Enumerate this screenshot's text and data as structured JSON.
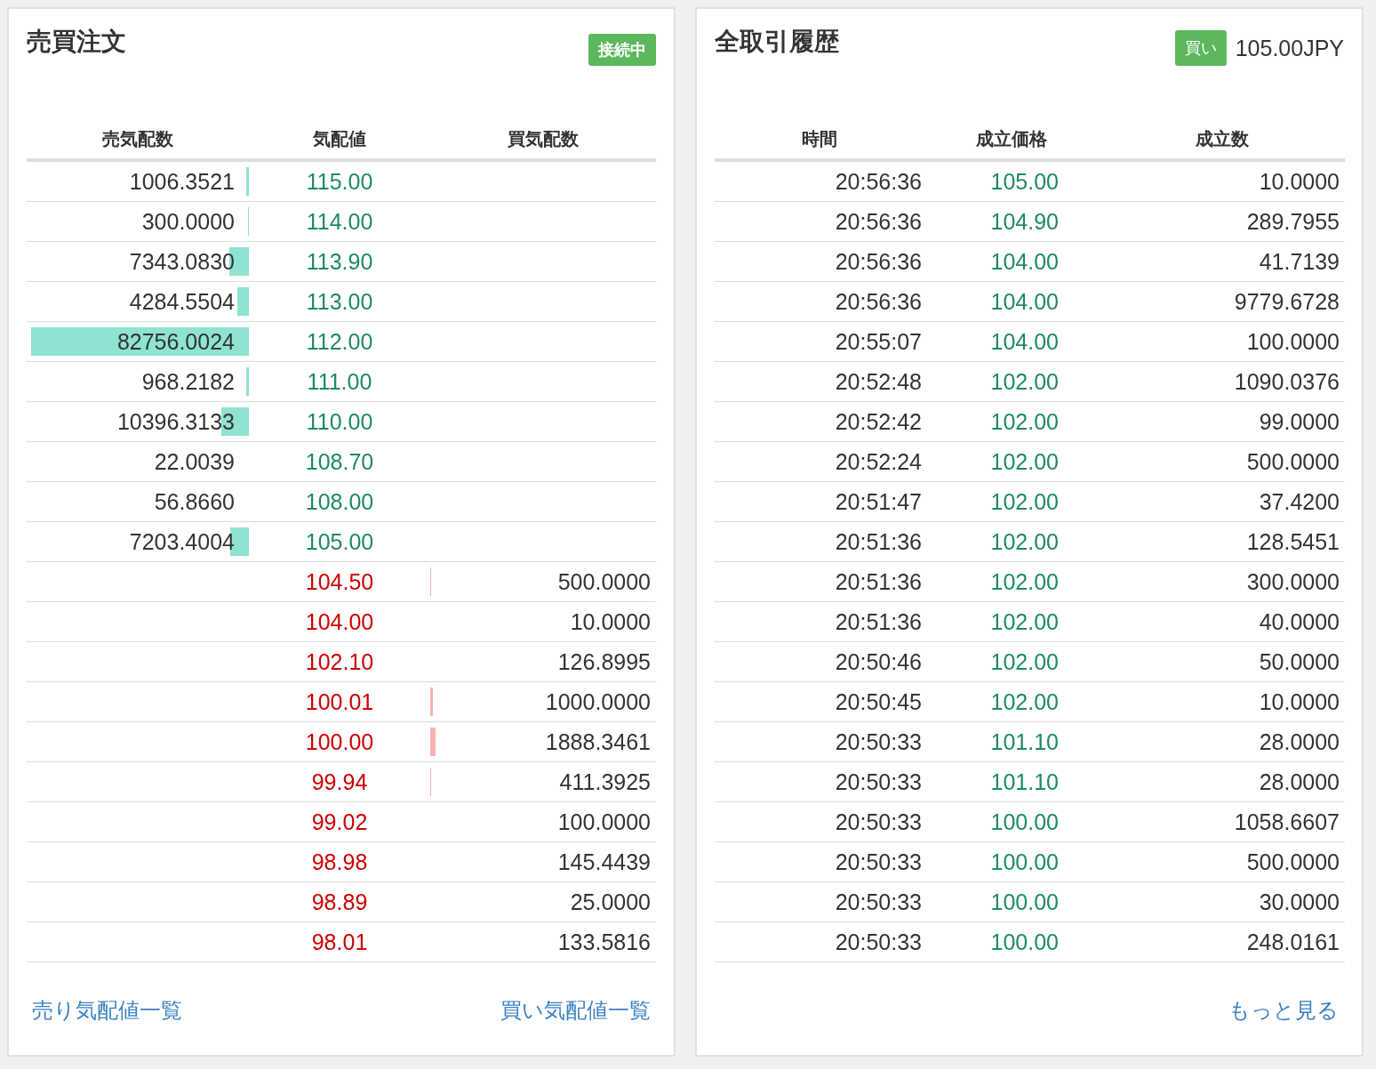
{
  "order_book": {
    "title": "売買注文",
    "status_badge": "接続中",
    "columns": [
      "売気配数",
      "気配値",
      "買気配数"
    ],
    "rows": [
      {
        "kind": "ask",
        "price": "115.00",
        "quantity": "1006.3521",
        "level": 0.012
      },
      {
        "kind": "ask",
        "price": "114.00",
        "quantity": "300.0000",
        "level": 0.004
      },
      {
        "kind": "ask",
        "price": "113.90",
        "quantity": "7343.0830",
        "level": 0.089
      },
      {
        "kind": "ask",
        "price": "113.00",
        "quantity": "4284.5504",
        "level": 0.052
      },
      {
        "kind": "ask",
        "price": "112.00",
        "quantity": "82756.0024",
        "level": 1
      },
      {
        "kind": "ask",
        "price": "111.00",
        "quantity": "968.2182",
        "level": 0.012
      },
      {
        "kind": "ask",
        "price": "110.00",
        "quantity": "10396.3133",
        "level": 0.126
      },
      {
        "kind": "ask",
        "price": "108.70",
        "quantity": "22.0039"
      },
      {
        "kind": "ask",
        "price": "108.00",
        "quantity": "56.8660"
      },
      {
        "kind": "ask",
        "price": "105.00",
        "quantity": "7203.4004",
        "level": 0.087
      },
      {
        "kind": "bid",
        "price": "104.50",
        "quantity": "500.0000",
        "level": 0.004
      },
      {
        "kind": "bid",
        "price": "104.00",
        "quantity": "10.0000"
      },
      {
        "kind": "bid",
        "price": "102.10",
        "quantity": "126.8995"
      },
      {
        "kind": "bid",
        "price": "100.01",
        "quantity": "1000.0000",
        "level": 0.012
      },
      {
        "kind": "bid",
        "price": "100.00",
        "quantity": "1888.3461",
        "level": 0.025
      },
      {
        "kind": "bid",
        "price": "99.94",
        "quantity": "411.3925",
        "level": 0.004
      },
      {
        "kind": "bid",
        "price": "99.02",
        "quantity": "100.0000"
      },
      {
        "kind": "bid",
        "price": "98.98",
        "quantity": "145.4439"
      },
      {
        "kind": "bid",
        "price": "98.89",
        "quantity": "25.0000"
      },
      {
        "kind": "bid",
        "price": "98.01",
        "quantity": "133.5816"
      }
    ],
    "links": [
      "売り気配値一覧",
      "買い気配値一覧"
    ]
  },
  "trade_history": {
    "title": "全取引履歴",
    "side_badge": "買い",
    "last_price": "105.00JPY",
    "columns": [
      "時間",
      "成立価格",
      "成立数"
    ],
    "rows": [
      {
        "time": "20:56:36",
        "price": "105.00",
        "quantity": "10.0000"
      },
      {
        "time": "20:56:36",
        "price": "104.90",
        "quantity": "289.7955"
      },
      {
        "time": "20:56:36",
        "price": "104.00",
        "quantity": "41.7139"
      },
      {
        "time": "20:56:36",
        "price": "104.00",
        "quantity": "9779.6728"
      },
      {
        "time": "20:55:07",
        "price": "104.00",
        "quantity": "100.0000"
      },
      {
        "time": "20:52:48",
        "price": "102.00",
        "quantity": "1090.0376"
      },
      {
        "time": "20:52:42",
        "price": "102.00",
        "quantity": "99.0000"
      },
      {
        "time": "20:52:24",
        "price": "102.00",
        "quantity": "500.0000"
      },
      {
        "time": "20:51:47",
        "price": "102.00",
        "quantity": "37.4200"
      },
      {
        "time": "20:51:36",
        "price": "102.00",
        "quantity": "128.5451"
      },
      {
        "time": "20:51:36",
        "price": "102.00",
        "quantity": "300.0000"
      },
      {
        "time": "20:51:36",
        "price": "102.00",
        "quantity": "40.0000"
      },
      {
        "time": "20:50:46",
        "price": "102.00",
        "quantity": "50.0000"
      },
      {
        "time": "20:50:45",
        "price": "102.00",
        "quantity": "10.0000"
      },
      {
        "time": "20:50:33",
        "price": "101.10",
        "quantity": "28.0000"
      },
      {
        "time": "20:50:33",
        "price": "101.10",
        "quantity": "28.0000"
      },
      {
        "time": "20:50:33",
        "price": "100.00",
        "quantity": "1058.6607"
      },
      {
        "time": "20:50:33",
        "price": "100.00",
        "quantity": "500.0000"
      },
      {
        "time": "20:50:33",
        "price": "100.00",
        "quantity": "30.0000"
      },
      {
        "time": "20:50:33",
        "price": "100.00",
        "quantity": "248.0161"
      }
    ],
    "link": "もっと見る"
  }
}
